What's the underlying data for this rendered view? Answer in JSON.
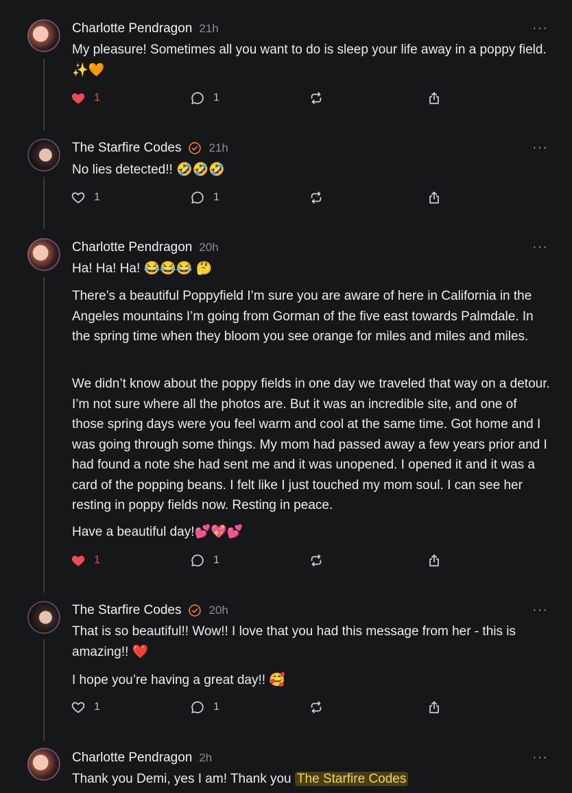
{
  "posts": [
    {
      "author": "Charlotte Pendragon",
      "verified": false,
      "time": "21h",
      "paragraphs": [
        "My pleasure! Sometimes all you want to do is sleep your life away in a poppy field. ✨🧡"
      ],
      "likes": "1",
      "liked": true,
      "replies": "1"
    },
    {
      "author": "The Starfire Codes",
      "verified": true,
      "time": "21h",
      "paragraphs": [
        "No lies detected!! 🤣🤣🤣"
      ],
      "likes": "1",
      "liked": false,
      "replies": "1"
    },
    {
      "author": "Charlotte Pendragon",
      "verified": false,
      "time": "20h",
      "paragraphs": [
        "Ha! Ha! Ha! 😂😂😂 🤔",
        "There’s a beautiful Poppyfield I’m sure you are aware of here in California in the Angeles mountains I’m going from Gorman of the five east towards Palmdale. In the spring time when they bloom you see orange for miles and miles and miles.",
        "We didn’t know about the poppy fields in one day we traveled that way on a detour. I’m not sure where all the photos are. But it was an incredible site, and one of those spring days were you feel warm and cool at the same time. Got home and I was going through some things. My mom had passed away a few years prior and I had found a note she had sent me and it was unopened. I opened it and it was a card of the popping beans. I felt like I just touched my mom soul. I can see her resting in poppy fields now. Resting in peace.",
        "Have a beautiful day!💕💖💕"
      ],
      "likes": "1",
      "liked": true,
      "replies": "1"
    },
    {
      "author": "The Starfire Codes",
      "verified": true,
      "time": "20h",
      "paragraphs": [
        "That is so beautiful!! Wow!! I love that you had this message from her - this is amazing!! ❤️",
        "I hope you’re having a great day!! 🥰"
      ],
      "likes": "1",
      "liked": false,
      "replies": "1"
    },
    {
      "author": "Charlotte Pendragon",
      "verified": false,
      "time": "2h",
      "paragraphs": [
        "Thank you Demi, yes I am! Thank you "
      ],
      "mention": "The Starfire Codes"
    }
  ],
  "more_label": "···",
  "colors": {
    "liked": "#ef4a55",
    "verified": "#f07b2a",
    "mention_bg": "#4a3f12",
    "mention_text": "#f4d44a"
  }
}
